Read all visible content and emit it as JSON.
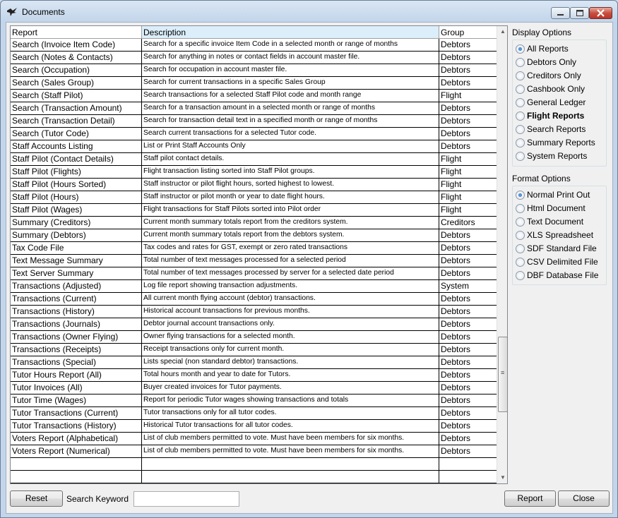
{
  "window": {
    "title": "Documents"
  },
  "table": {
    "headers": {
      "report": "Report",
      "description": "Description",
      "group": "Group"
    },
    "rows": [
      {
        "report": "Search (Invoice Item Code)",
        "description": "Search for a specific invoice Item Code in a selected month or range of months",
        "group": "Debtors"
      },
      {
        "report": "Search (Notes & Contacts)",
        "description": "Search for anything in notes or contact fields in account master file.",
        "group": "Debtors"
      },
      {
        "report": "Search (Occupation)",
        "description": "Search for occupation in account master file.",
        "group": "Debtors"
      },
      {
        "report": "Search (Sales Group)",
        "description": "Search for current transactions in a specific Sales Group",
        "group": "Debtors"
      },
      {
        "report": "Search (Staff Pilot)",
        "description": "Search transactions for a selected Staff Pilot code and month range",
        "group": "Flight"
      },
      {
        "report": "Search (Transaction Amount)",
        "description": "Search for a transaction amount in a selected month or range of months",
        "group": "Debtors"
      },
      {
        "report": "Search (Transaction Detail)",
        "description": "Search for transaction detail text in a specified month or range of months",
        "group": "Debtors"
      },
      {
        "report": "Search (Tutor Code)",
        "description": "Search current transactions for a selected Tutor code.",
        "group": "Debtors"
      },
      {
        "report": "Staff Accounts Listing",
        "description": "List or Print Staff Accounts Only",
        "group": "Debtors"
      },
      {
        "report": "Staff Pilot (Contact Details)",
        "description": "Staff pilot contact details.",
        "group": "Flight"
      },
      {
        "report": "Staff Pilot (Flights)",
        "description": "Flight transaction listing sorted into Staff Pilot groups.",
        "group": "Flight"
      },
      {
        "report": "Staff Pilot (Hours Sorted)",
        "description": "Staff instructor or pilot flight hours, sorted highest to lowest.",
        "group": "Flight"
      },
      {
        "report": "Staff Pilot (Hours)",
        "description": "Staff instructor or pilot month or year to date flight hours.",
        "group": "Flight"
      },
      {
        "report": "Staff Pilot (Wages)",
        "description": "Flight transactions for Staff Pilots sorted into Pilot order",
        "group": "Flight"
      },
      {
        "report": "Summary (Creditors)",
        "description": "Current month summary totals report from the creditors system.",
        "group": "Creditors"
      },
      {
        "report": "Summary (Debtors)",
        "description": "Current month summary totals report from the debtors system.",
        "group": "Debtors"
      },
      {
        "report": "Tax Code File",
        "description": "Tax codes and rates for GST, exempt or zero rated transactions",
        "group": "Debtors"
      },
      {
        "report": "Text Message Summary",
        "description": "Total number of text messages processed for a selected period",
        "group": "Debtors"
      },
      {
        "report": "Text Server Summary",
        "description": "Total number of text messages processed by server for a selected date period",
        "group": "Debtors"
      },
      {
        "report": "Transactions (Adjusted)",
        "description": "Log file report showing transaction adjustments.",
        "group": "System"
      },
      {
        "report": "Transactions (Current)",
        "description": "All current month flying account (debtor) transactions.",
        "group": "Debtors"
      },
      {
        "report": "Transactions (History)",
        "description": "Historical account transactions for previous months.",
        "group": "Debtors"
      },
      {
        "report": "Transactions (Journals)",
        "description": "Debtor journal account transactions only.",
        "group": "Debtors"
      },
      {
        "report": "Transactions (Owner Flying)",
        "description": "Owner flying transactions for a selected month.",
        "group": "Debtors"
      },
      {
        "report": "Transactions (Receipts)",
        "description": "Receipt transactions only for current month.",
        "group": "Debtors"
      },
      {
        "report": "Transactions (Special)",
        "description": "Lists special (non standard debtor) transactions.",
        "group": "Debtors"
      },
      {
        "report": "Tutor Hours Report (All)",
        "description": "Total hours month and year to date for Tutors.",
        "group": "Debtors"
      },
      {
        "report": "Tutor Invoices (All)",
        "description": "Buyer created invoices for Tutor payments.",
        "group": "Debtors"
      },
      {
        "report": "Tutor Time (Wages)",
        "description": "Report for periodic Tutor wages showing transactions and totals",
        "group": "Debtors"
      },
      {
        "report": "Tutor Transactions (Current)",
        "description": "Tutor transactions only for all tutor codes.",
        "group": "Debtors"
      },
      {
        "report": "Tutor Transactions (History)",
        "description": "Historical Tutor transactions for all tutor codes.",
        "group": "Debtors"
      },
      {
        "report": "Voters Report (Alphabetical)",
        "description": "List of club members permitted to vote. Must have been members for six months.",
        "group": "Debtors"
      },
      {
        "report": "Voters Report (Numerical)",
        "description": "List of club members permitted to vote. Must have been members for six months.",
        "group": "Debtors"
      },
      {
        "report": "",
        "description": "",
        "group": ""
      },
      {
        "report": "",
        "description": "",
        "group": ""
      }
    ]
  },
  "display_options": {
    "label": "Display Options",
    "selected": "All Reports",
    "items": [
      "All Reports",
      "Debtors Only",
      "Creditors Only",
      "Cashbook Only",
      "General Ledger",
      "Flight Reports",
      "Search Reports",
      "Summary Reports",
      "System Reports"
    ],
    "bold_item": "Flight Reports"
  },
  "format_options": {
    "label": "Format Options",
    "selected": "Normal Print Out",
    "items": [
      "Normal Print Out",
      "Html Document",
      "Text Document",
      "XLS Spreadsheet",
      "SDF Standard File",
      "CSV Delimited File",
      "DBF Database File"
    ]
  },
  "bottom": {
    "reset_label": "Reset",
    "search_label": "Search Keyword",
    "search_value": "",
    "report_label": "Report",
    "close_label": "Close"
  },
  "colors": {
    "header_highlight": "#dbeef9",
    "title_bar": "#c3d5ea",
    "close_button": "#c75040"
  },
  "icons": {
    "app": "bird-icon",
    "minimize": "minimize-icon",
    "maximize": "maximize-icon",
    "close": "close-icon"
  }
}
